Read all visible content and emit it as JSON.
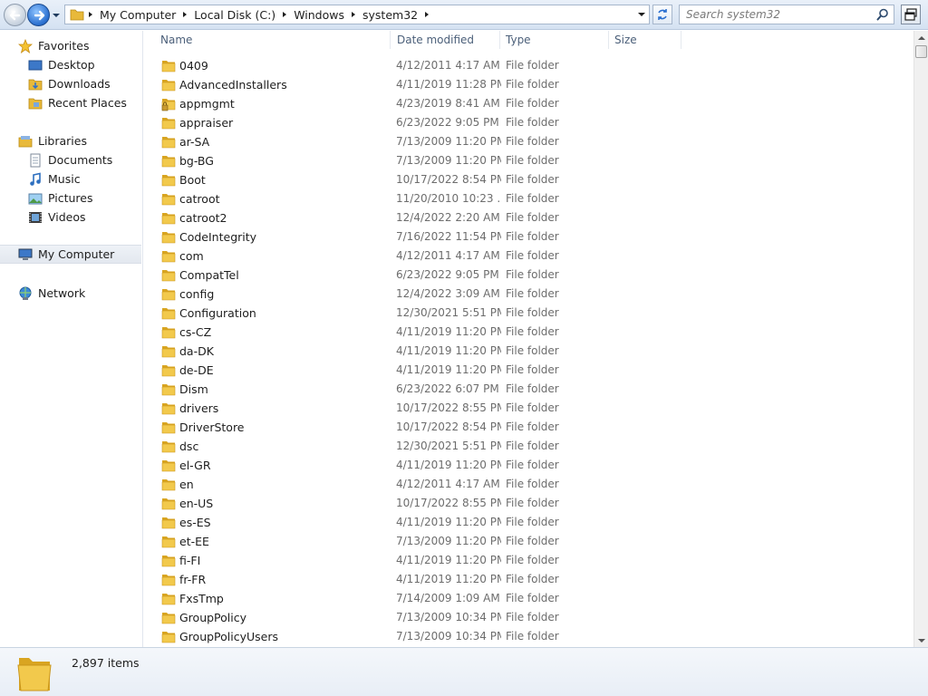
{
  "toolbar": {
    "breadcrumbs": [
      "My Computer",
      "Local Disk (C:)",
      "Windows",
      "system32"
    ],
    "search_placeholder": "Search system32"
  },
  "sidebar": {
    "items": [
      {
        "label": "Favorites",
        "icon": "star-icon",
        "level": 0
      },
      {
        "label": "Desktop",
        "icon": "desktop-icon",
        "level": 1
      },
      {
        "label": "Downloads",
        "icon": "downloads-icon",
        "level": 1
      },
      {
        "label": "Recent Places",
        "icon": "recent-places-icon",
        "level": 1
      },
      {
        "label": "Libraries",
        "icon": "libraries-icon",
        "level": 0
      },
      {
        "label": "Documents",
        "icon": "documents-icon",
        "level": 1
      },
      {
        "label": "Music",
        "icon": "music-icon",
        "level": 1
      },
      {
        "label": "Pictures",
        "icon": "pictures-icon",
        "level": 1
      },
      {
        "label": "Videos",
        "icon": "videos-icon",
        "level": 1
      },
      {
        "label": "My Computer",
        "icon": "computer-icon",
        "level": 0,
        "selected": true
      },
      {
        "label": "Network",
        "icon": "network-icon",
        "level": 0
      }
    ]
  },
  "columns": {
    "name": "Name",
    "date": "Date modified",
    "type": "Type",
    "size": "Size"
  },
  "files": [
    {
      "name": "0409",
      "date": "4/12/2011 4:17 AM",
      "type": "File folder"
    },
    {
      "name": "AdvancedInstallers",
      "date": "4/11/2019 11:28 PM",
      "type": "File folder"
    },
    {
      "name": "appmgmt",
      "date": "4/23/2019 8:41 AM",
      "type": "File folder",
      "locked": true
    },
    {
      "name": "appraiser",
      "date": "6/23/2022 9:05 PM",
      "type": "File folder"
    },
    {
      "name": "ar-SA",
      "date": "7/13/2009 11:20 PM",
      "type": "File folder"
    },
    {
      "name": "bg-BG",
      "date": "7/13/2009 11:20 PM",
      "type": "File folder"
    },
    {
      "name": "Boot",
      "date": "10/17/2022 8:54 PM",
      "type": "File folder"
    },
    {
      "name": "catroot",
      "date": "11/20/2010 10:23 ...",
      "type": "File folder"
    },
    {
      "name": "catroot2",
      "date": "12/4/2022 2:20 AM",
      "type": "File folder"
    },
    {
      "name": "CodeIntegrity",
      "date": "7/16/2022 11:54 PM",
      "type": "File folder"
    },
    {
      "name": "com",
      "date": "4/12/2011 4:17 AM",
      "type": "File folder"
    },
    {
      "name": "CompatTel",
      "date": "6/23/2022 9:05 PM",
      "type": "File folder"
    },
    {
      "name": "config",
      "date": "12/4/2022 3:09 AM",
      "type": "File folder"
    },
    {
      "name": "Configuration",
      "date": "12/30/2021 5:51 PM",
      "type": "File folder"
    },
    {
      "name": "cs-CZ",
      "date": "4/11/2019 11:20 PM",
      "type": "File folder"
    },
    {
      "name": "da-DK",
      "date": "4/11/2019 11:20 PM",
      "type": "File folder"
    },
    {
      "name": "de-DE",
      "date": "4/11/2019 11:20 PM",
      "type": "File folder"
    },
    {
      "name": "Dism",
      "date": "6/23/2022 6:07 PM",
      "type": "File folder"
    },
    {
      "name": "drivers",
      "date": "10/17/2022 8:55 PM",
      "type": "File folder"
    },
    {
      "name": "DriverStore",
      "date": "10/17/2022 8:54 PM",
      "type": "File folder"
    },
    {
      "name": "dsc",
      "date": "12/30/2021 5:51 PM",
      "type": "File folder"
    },
    {
      "name": "el-GR",
      "date": "4/11/2019 11:20 PM",
      "type": "File folder"
    },
    {
      "name": "en",
      "date": "4/12/2011 4:17 AM",
      "type": "File folder"
    },
    {
      "name": "en-US",
      "date": "10/17/2022 8:55 PM",
      "type": "File folder"
    },
    {
      "name": "es-ES",
      "date": "4/11/2019 11:20 PM",
      "type": "File folder"
    },
    {
      "name": "et-EE",
      "date": "7/13/2009 11:20 PM",
      "type": "File folder"
    },
    {
      "name": "fi-FI",
      "date": "4/11/2019 11:20 PM",
      "type": "File folder"
    },
    {
      "name": "fr-FR",
      "date": "4/11/2019 11:20 PM",
      "type": "File folder"
    },
    {
      "name": "FxsTmp",
      "date": "7/14/2009 1:09 AM",
      "type": "File folder"
    },
    {
      "name": "GroupPolicy",
      "date": "7/13/2009 10:34 PM",
      "type": "File folder"
    },
    {
      "name": "GroupPolicyUsers",
      "date": "7/13/2009 10:34 PM",
      "type": "File folder"
    }
  ],
  "details": {
    "count": "2,897 items"
  },
  "colors": {
    "folder": "#f2c94c",
    "folder_dark": "#d9a521",
    "accent": "#2a6fcf"
  }
}
